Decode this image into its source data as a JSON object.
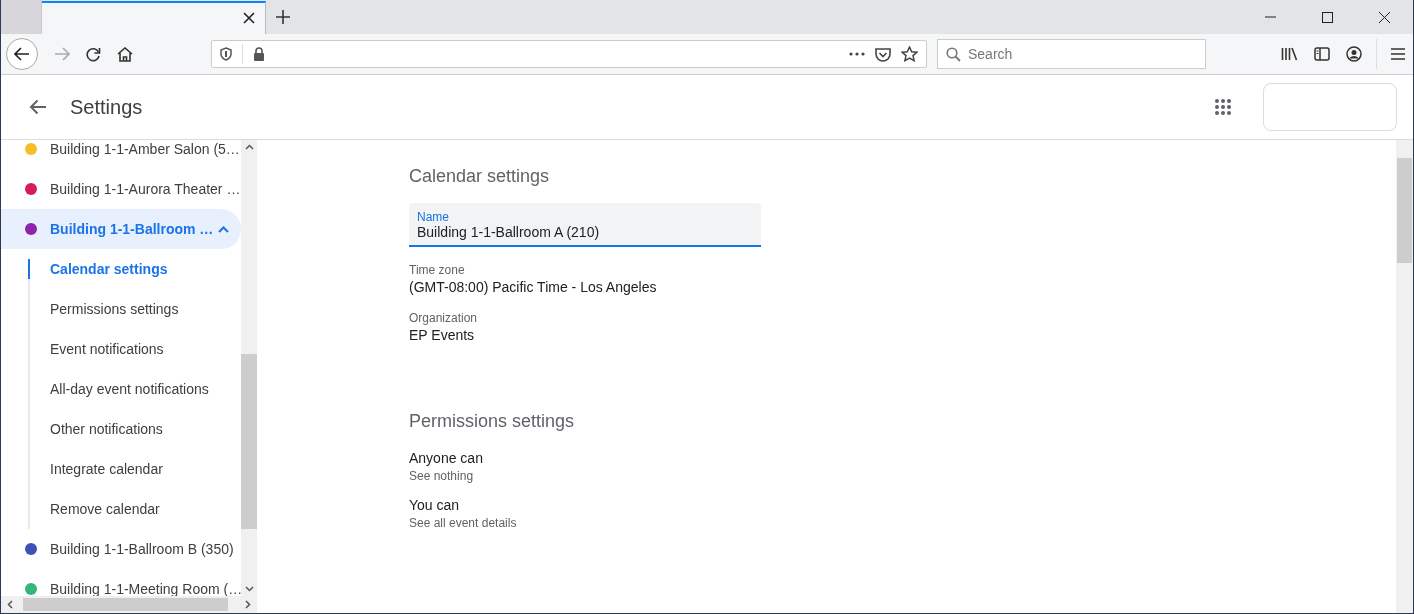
{
  "browser": {
    "search": {
      "placeholder": "Search"
    }
  },
  "app": {
    "title": "Settings"
  },
  "sidebar": {
    "calendars": [
      {
        "name": "Building 1-1-Amber Salon (5…",
        "color": "#f6bf26",
        "selected": false
      },
      {
        "name": "Building 1-1-Aurora Theater …",
        "color": "#d81b60",
        "selected": false
      },
      {
        "name": "Building 1-1-Ballroom …",
        "color": "#8e24aa",
        "selected": true,
        "expanded": true,
        "sections": [
          {
            "label": "Calendar settings",
            "selected": true
          },
          {
            "label": "Permissions settings",
            "selected": false
          },
          {
            "label": "Event notifications",
            "selected": false
          },
          {
            "label": "All-day event notifications",
            "selected": false
          },
          {
            "label": "Other notifications",
            "selected": false
          },
          {
            "label": "Integrate calendar",
            "selected": false
          },
          {
            "label": "Remove calendar",
            "selected": false
          }
        ]
      },
      {
        "name": "Building 1-1-Ballroom B (350)",
        "color": "#3f51b5",
        "selected": false
      },
      {
        "name": "Building 1-1-Meeting Room (…",
        "color": "#33b679",
        "selected": false
      }
    ]
  },
  "calendar_settings": {
    "title": "Calendar settings",
    "name_field": {
      "label": "Name",
      "value": "Building 1-1-Ballroom A (210)"
    },
    "details": [
      {
        "label": "Time zone",
        "value": "(GMT-08:00) Pacific Time - Los Angeles"
      },
      {
        "label": "Organization",
        "value": "EP Events"
      }
    ]
  },
  "permissions_settings": {
    "title": "Permissions settings",
    "items": [
      {
        "label": "Anyone can",
        "value": "See nothing"
      },
      {
        "label": "You can",
        "value": "See all event details"
      }
    ]
  }
}
